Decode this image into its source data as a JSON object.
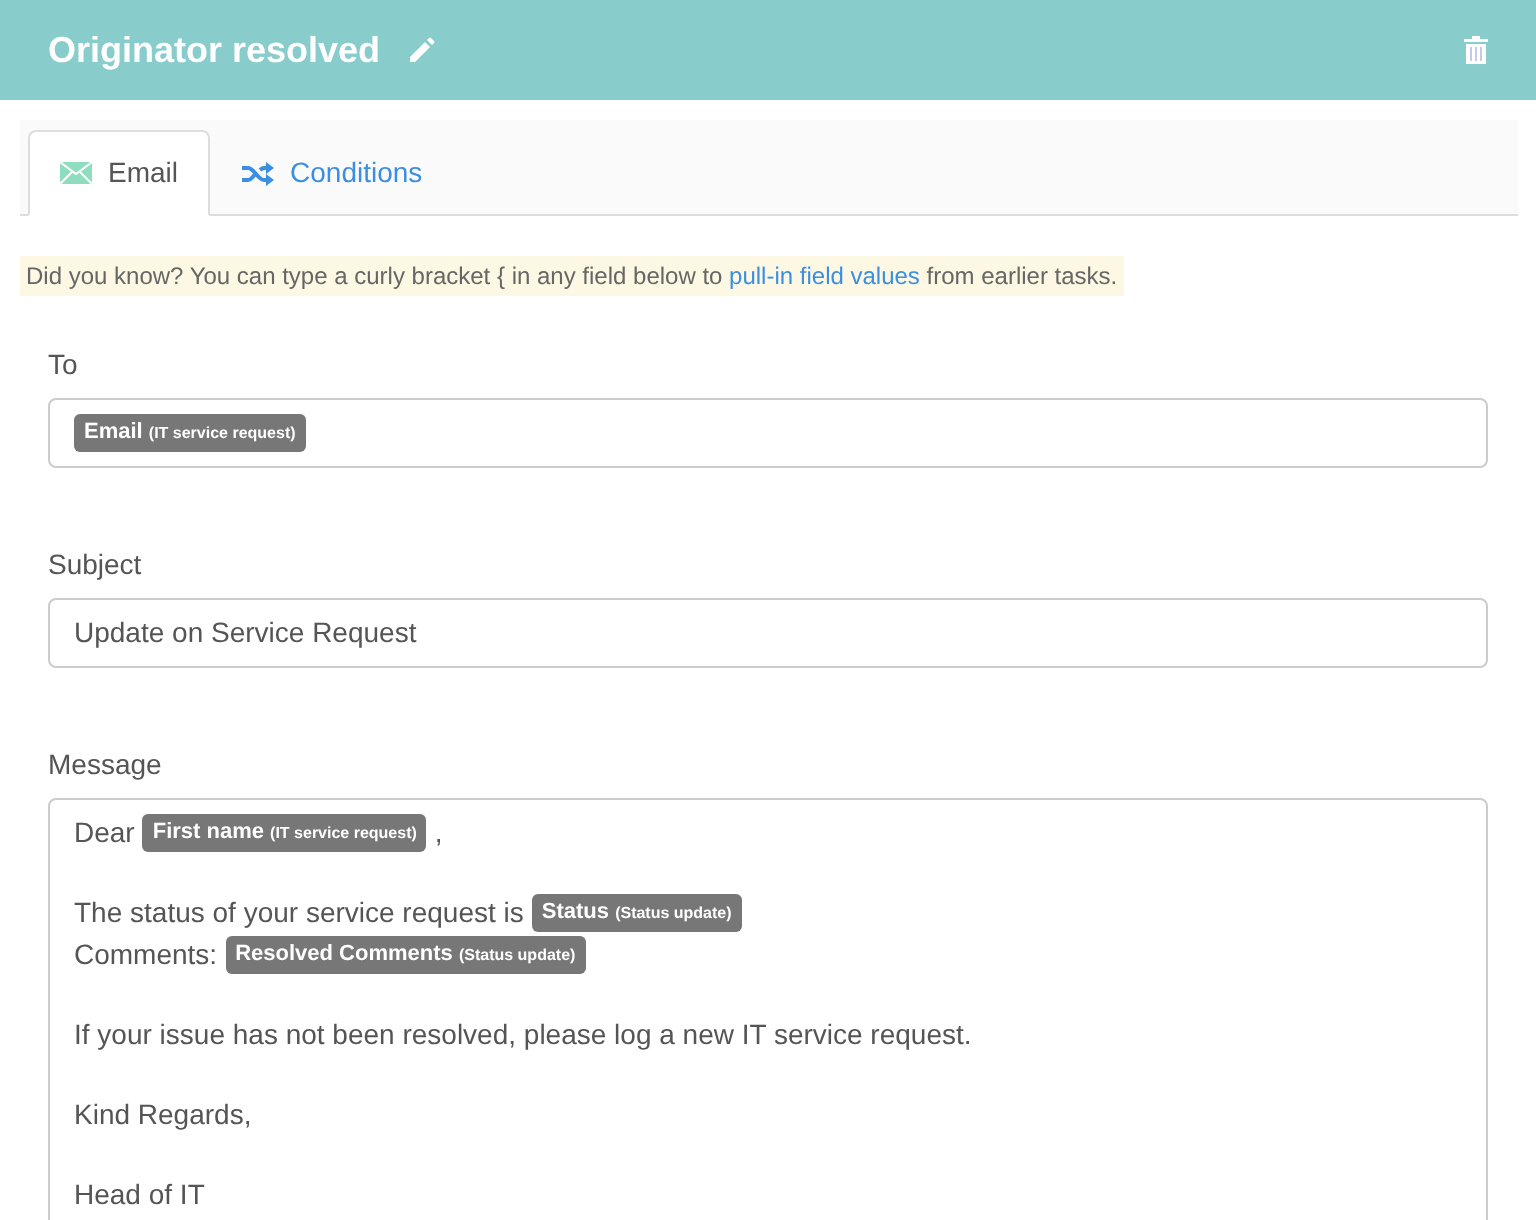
{
  "header": {
    "title": "Originator resolved"
  },
  "tabs": [
    {
      "label": "Email",
      "selected": true,
      "kind": "email"
    },
    {
      "label": "Conditions",
      "selected": false,
      "kind": "conditions"
    }
  ],
  "hint": {
    "before": "Did you know? You can type a curly bracket { in any field below to ",
    "link": "pull-in field values",
    "after": " from earlier tasks."
  },
  "to": {
    "label": "To",
    "tokens": [
      {
        "field": "Email",
        "source": "(IT service request)"
      }
    ]
  },
  "subject": {
    "label": "Subject",
    "value": "Update on Service Request"
  },
  "message": {
    "label": "Message",
    "paragraphs": [
      [
        [
          {
            "kind": "text",
            "text": "Dear"
          },
          {
            "kind": "token",
            "field": "First name",
            "source": "(IT service request)"
          },
          {
            "kind": "text",
            "text": ","
          }
        ]
      ],
      [
        [
          {
            "kind": "text",
            "text": "The status of your service request is"
          },
          {
            "kind": "token",
            "field": "Status",
            "source": "(Status update)"
          }
        ],
        [
          {
            "kind": "text",
            "text": "Comments:"
          },
          {
            "kind": "token",
            "field": "Resolved Comments",
            "source": "(Status update)"
          }
        ]
      ],
      [
        [
          {
            "kind": "text",
            "text": "If your issue has not been resolved, please log a new IT service request."
          }
        ]
      ],
      [
        [
          {
            "kind": "text",
            "text": "Kind Regards,"
          }
        ]
      ],
      [
        [
          {
            "kind": "text",
            "text": "Head of IT"
          }
        ]
      ]
    ]
  }
}
